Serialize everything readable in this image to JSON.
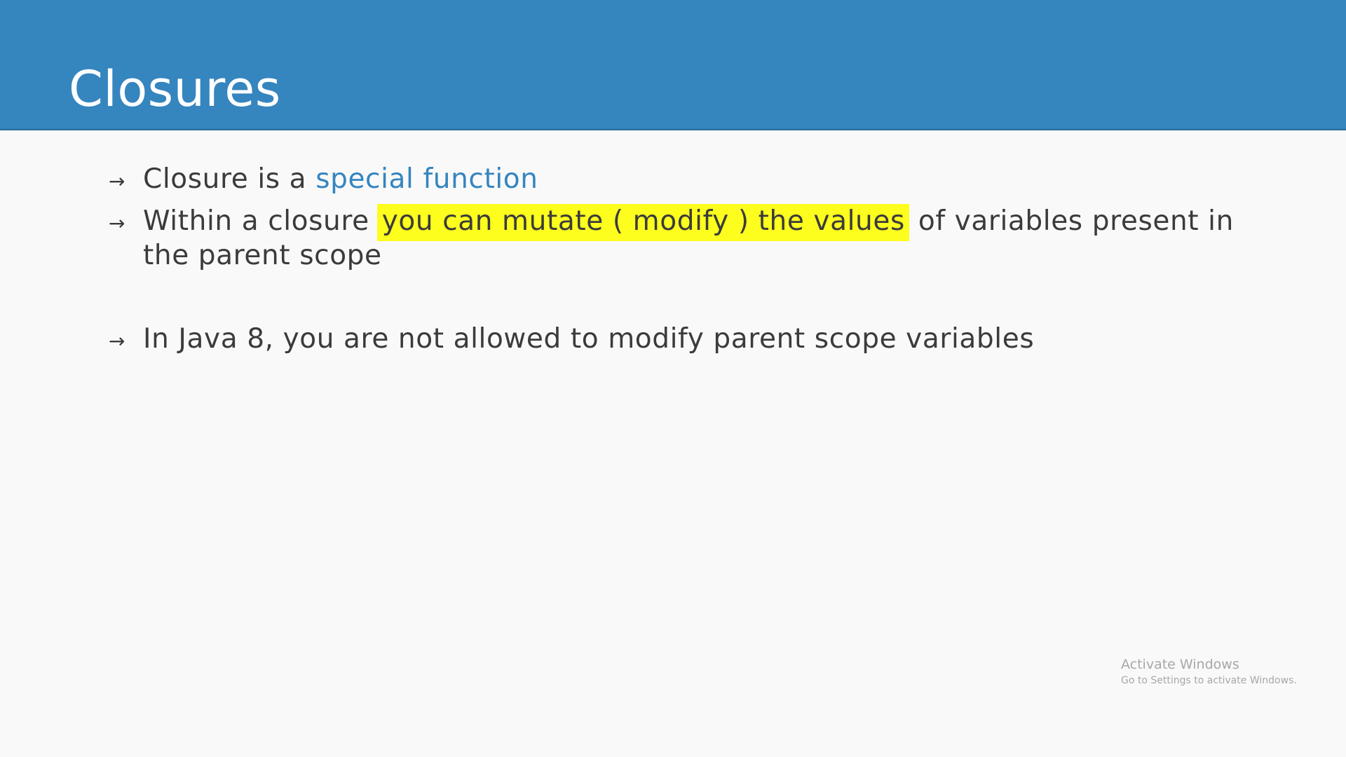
{
  "slide": {
    "title": "Closures",
    "bullets": [
      {
        "arrow": "→",
        "text_before": "Closure is a ",
        "accent": "special function"
      },
      {
        "arrow": "→",
        "text_before": "Within a closure ",
        "highlight": "you can mutate ( modify ) the values",
        "text_after": " of variables present in the parent scope"
      },
      {
        "arrow": "→",
        "text": "In Java 8, you are not allowed to modify parent scope variables"
      }
    ]
  },
  "watermark": {
    "title": "Activate Windows",
    "subtitle": "Go to Settings to activate Windows."
  },
  "colors": {
    "header": "#3585bf",
    "accent": "#3585bf",
    "highlight": "#fdfd1e",
    "text": "#3b3b3b"
  }
}
